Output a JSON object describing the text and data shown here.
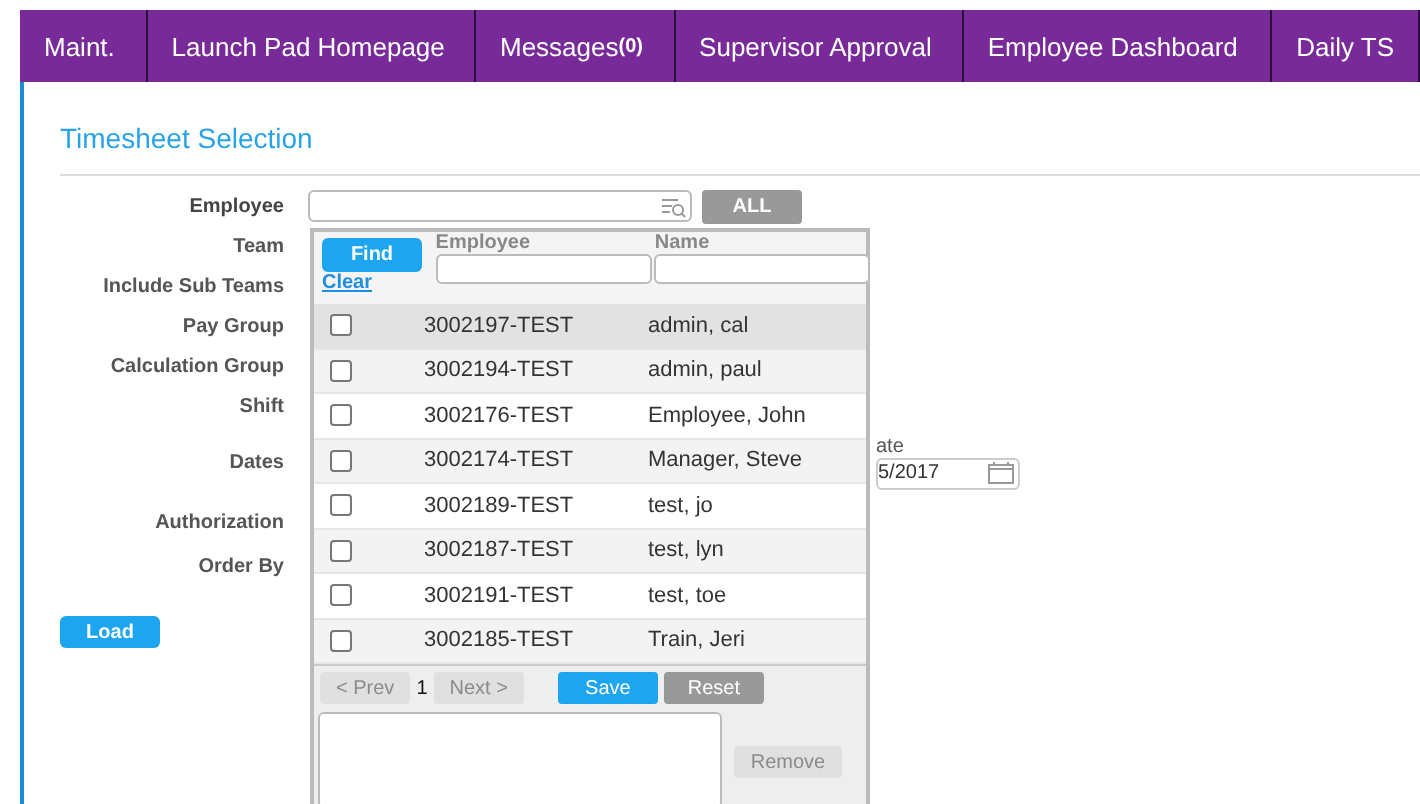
{
  "nav_tabs": [
    {
      "label": "Maint."
    },
    {
      "label": "Launch Pad Homepage"
    },
    {
      "label": "Messages",
      "count": "(0)"
    },
    {
      "label": "Supervisor Approval"
    },
    {
      "label": "Employee Dashboard"
    },
    {
      "label": "Daily TS"
    }
  ],
  "page_title": "Timesheet Selection",
  "form": {
    "labels": [
      "Employee",
      "Team",
      "Include Sub Teams",
      "Pay Group",
      "Calculation Group",
      "Shift",
      "Dates",
      "Authorization",
      "Order By"
    ],
    "all_button": "ALL",
    "end_date_label": "ate",
    "end_date_value": "5/2017",
    "load_button": "Load"
  },
  "picker": {
    "find_button": "Find",
    "clear_link": "Clear",
    "columns": [
      "Employee",
      "Name"
    ],
    "rows": [
      {
        "employee": "3002197-TEST",
        "name": "admin, cal",
        "checked": false,
        "selected": true
      },
      {
        "employee": "3002194-TEST",
        "name": "admin, paul",
        "checked": false,
        "selected": false
      },
      {
        "employee": "3002176-TEST",
        "name": "Employee, John",
        "checked": false,
        "selected": false
      },
      {
        "employee": "3002174-TEST",
        "name": "Manager, Steve",
        "checked": false,
        "selected": false
      },
      {
        "employee": "3002189-TEST",
        "name": "test, jo",
        "checked": false,
        "selected": false
      },
      {
        "employee": "3002187-TEST",
        "name": "test, lyn",
        "checked": false,
        "selected": false
      },
      {
        "employee": "3002191-TEST",
        "name": "test, toe",
        "checked": false,
        "selected": false
      },
      {
        "employee": "3002185-TEST",
        "name": "Train, Jeri",
        "checked": false,
        "selected": false
      }
    ],
    "prev_button": "< Prev",
    "page": "1",
    "next_button": "Next >",
    "save_button": "Save",
    "reset_button": "Reset",
    "remove_button": "Remove"
  }
}
